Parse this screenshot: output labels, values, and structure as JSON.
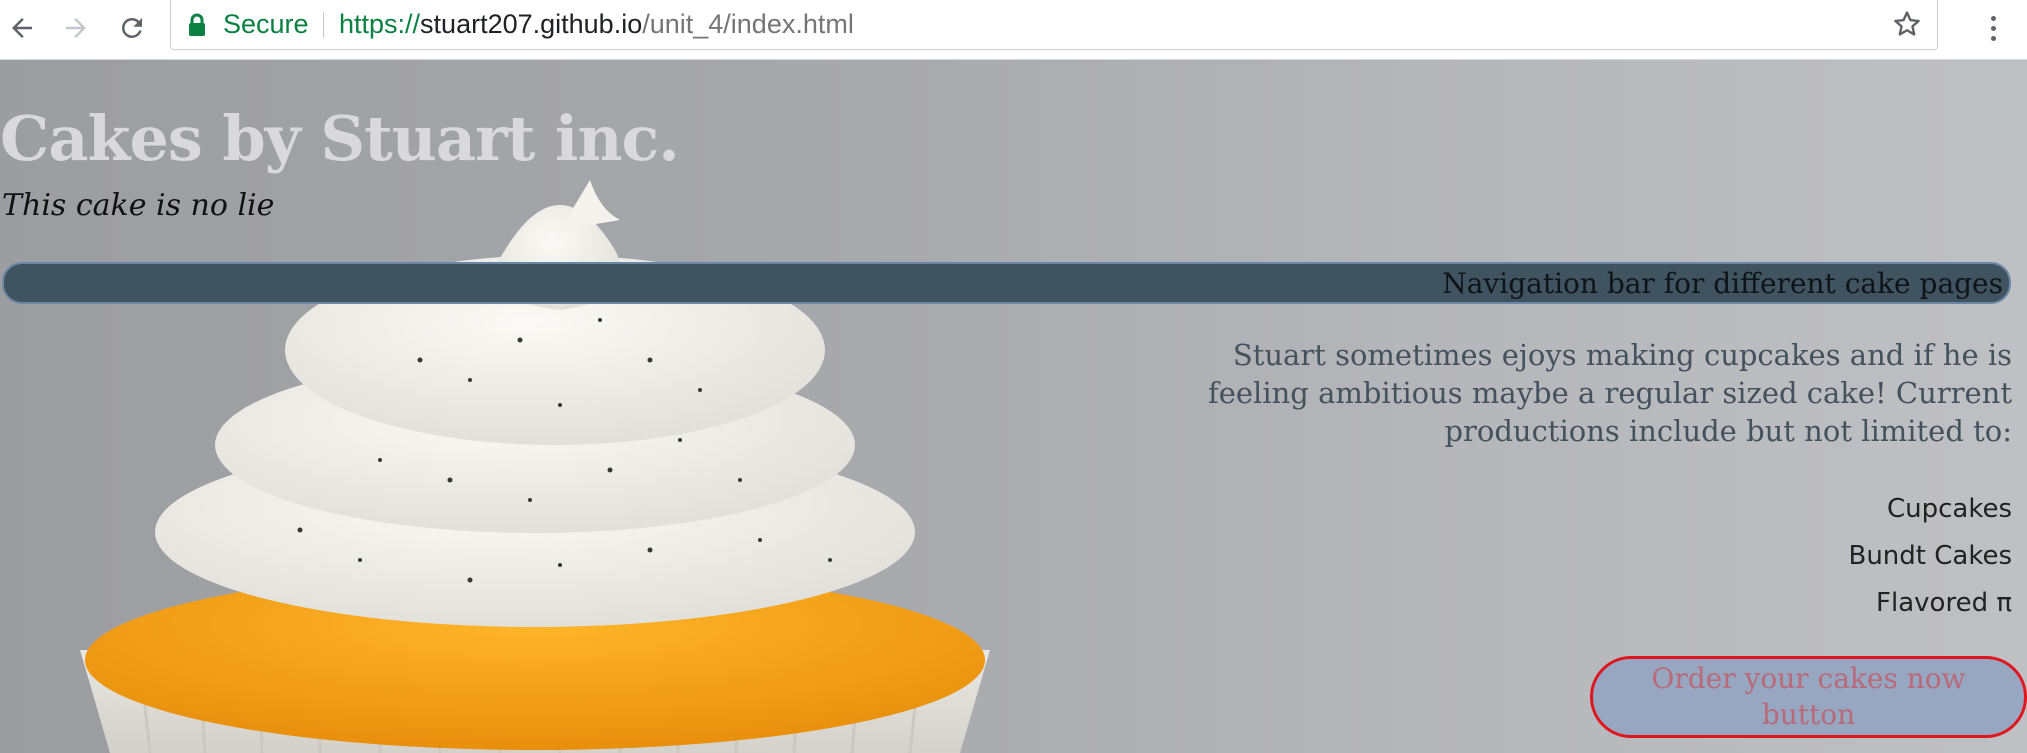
{
  "browser": {
    "security_label": "Secure",
    "url_scheme": "https://",
    "url_host": "stuart207.github.io",
    "url_path": "/unit_4/index.html",
    "icons": [
      "back-icon",
      "forward-icon",
      "reload-icon",
      "lock-icon",
      "star-icon",
      "menu-icon"
    ],
    "secure_color": "#0b8043"
  },
  "page": {
    "title": "Cakes by Stuart inc.",
    "tagline": "This cake is no lie",
    "navbar_label": "Navigation bar for different cake pages",
    "intro": "Stuart sometimes ejoys making cupcakes and if he is feeling ambitious maybe a regular sized cake! Current productions include but not limited to:",
    "cakes": [
      "Cupcakes",
      "Bundt Cakes",
      "Flavored π"
    ],
    "order_button": "Order your cakes now button",
    "colors": {
      "navbar": "#405360",
      "navbar_border": "#6b87a6",
      "order_button_bg": "#97a6c1",
      "order_button_border": "#e0161e",
      "order_button_text": "#b86a79"
    }
  }
}
